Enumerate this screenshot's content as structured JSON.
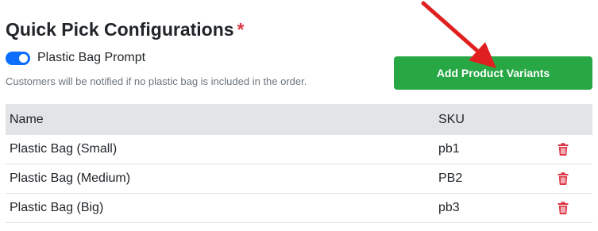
{
  "section": {
    "title": "Quick Pick Configurations",
    "required_mark": "*"
  },
  "toggle": {
    "label": "Plastic Bag Prompt",
    "enabled": true
  },
  "help_text": "Customers will be notified if no plastic bag is included in the order.",
  "add_button": {
    "label": "Add Product Variants"
  },
  "table": {
    "headers": {
      "name": "Name",
      "sku": "SKU"
    },
    "rows": [
      {
        "name": "Plastic Bag (Small)",
        "sku": "pb1",
        "action_icon": "trash-icon"
      },
      {
        "name": "Plastic Bag (Medium)",
        "sku": "PB2",
        "action_icon": "trash-icon"
      },
      {
        "name": "Plastic Bag (Big)",
        "sku": "pb3",
        "action_icon": "trash-icon"
      }
    ]
  },
  "colors": {
    "primary": "#0d6efd",
    "success": "#28a745",
    "danger": "#dc3545",
    "header_bg": "#e2e4e8",
    "annotation_arrow": "#e02020"
  }
}
